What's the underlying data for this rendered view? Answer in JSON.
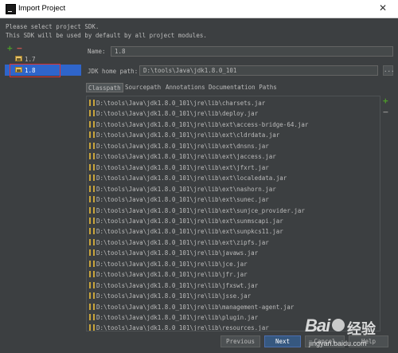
{
  "window": {
    "title": "Import Project",
    "close_glyph": "✕"
  },
  "intro": {
    "line1": "Please select project SDK.",
    "line2": "This SDK will be used by default by all project modules."
  },
  "left_toolbar": {
    "add_glyph": "+",
    "remove_glyph": "−"
  },
  "sdk_tree": {
    "items": [
      {
        "label": "1.7",
        "selected": false
      },
      {
        "label": "1.8",
        "selected": true
      }
    ]
  },
  "name_field": {
    "label": "Name:",
    "value": "1.8"
  },
  "home_field": {
    "label": "JDK home path:",
    "value": "D:\\tools\\Java\\jdk1.8.0_101",
    "browse_label": "..."
  },
  "tabs": [
    {
      "label": "Classpath",
      "active": true
    },
    {
      "label": "Sourcepath",
      "active": false
    },
    {
      "label": "Annotations",
      "active": false
    },
    {
      "label": "Documentation Paths",
      "active": false
    }
  ],
  "list_toolbar": {
    "add_glyph": "+",
    "remove_glyph": "−"
  },
  "classpath": [
    "D:\\tools\\Java\\jdk1.8.0_101\\jre\\lib\\charsets.jar",
    "D:\\tools\\Java\\jdk1.8.0_101\\jre\\lib\\deploy.jar",
    "D:\\tools\\Java\\jdk1.8.0_101\\jre\\lib\\ext\\access-bridge-64.jar",
    "D:\\tools\\Java\\jdk1.8.0_101\\jre\\lib\\ext\\cldrdata.jar",
    "D:\\tools\\Java\\jdk1.8.0_101\\jre\\lib\\ext\\dnsns.jar",
    "D:\\tools\\Java\\jdk1.8.0_101\\jre\\lib\\ext\\jaccess.jar",
    "D:\\tools\\Java\\jdk1.8.0_101\\jre\\lib\\ext\\jfxrt.jar",
    "D:\\tools\\Java\\jdk1.8.0_101\\jre\\lib\\ext\\localedata.jar",
    "D:\\tools\\Java\\jdk1.8.0_101\\jre\\lib\\ext\\nashorn.jar",
    "D:\\tools\\Java\\jdk1.8.0_101\\jre\\lib\\ext\\sunec.jar",
    "D:\\tools\\Java\\jdk1.8.0_101\\jre\\lib\\ext\\sunjce_provider.jar",
    "D:\\tools\\Java\\jdk1.8.0_101\\jre\\lib\\ext\\sunmscapi.jar",
    "D:\\tools\\Java\\jdk1.8.0_101\\jre\\lib\\ext\\sunpkcs11.jar",
    "D:\\tools\\Java\\jdk1.8.0_101\\jre\\lib\\ext\\zipfs.jar",
    "D:\\tools\\Java\\jdk1.8.0_101\\jre\\lib\\javaws.jar",
    "D:\\tools\\Java\\jdk1.8.0_101\\jre\\lib\\jce.jar",
    "D:\\tools\\Java\\jdk1.8.0_101\\jre\\lib\\jfr.jar",
    "D:\\tools\\Java\\jdk1.8.0_101\\jre\\lib\\jfxswt.jar",
    "D:\\tools\\Java\\jdk1.8.0_101\\jre\\lib\\jsse.jar",
    "D:\\tools\\Java\\jdk1.8.0_101\\jre\\lib\\management-agent.jar",
    "D:\\tools\\Java\\jdk1.8.0_101\\jre\\lib\\plugin.jar",
    "D:\\tools\\Java\\jdk1.8.0_101\\jre\\lib\\resources.jar"
  ],
  "buttons": {
    "previous": "Previous",
    "next": "Next",
    "cancel": "Cancel",
    "help": "Help"
  },
  "watermark": {
    "logo": "Bai",
    "text": "经验",
    "url": "jingyan.baidu.com"
  },
  "colors": {
    "accent": "#2f65ca",
    "highlight_box": "#e0322b",
    "add": "#4c9a2a",
    "remove": "#c75450"
  }
}
